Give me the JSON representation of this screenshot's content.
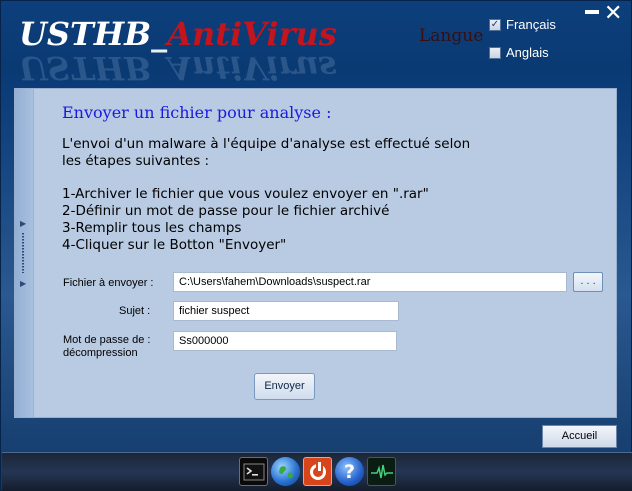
{
  "header": {
    "logo_part1": "USTHB_",
    "logo_part2": "AntiVirus",
    "logo_full": "USTHB_AntiVirus",
    "langue_label": "Langue",
    "lang_options": [
      {
        "label": "Français",
        "checked": true
      },
      {
        "label": "Anglais",
        "checked": false
      }
    ]
  },
  "panel": {
    "title": "Envoyer un fichier pour analyse :",
    "intro_line1": "L'envoi d'un malware à  l'équipe d'analyse est effectué selon",
    "intro_line2": "les étapes suivantes :",
    "steps": [
      "1-Archiver le fichier que vous voulez envoyer en \".rar\"",
      "2-Définir un mot de passe pour le fichier archivé",
      "3-Remplir tous les champs",
      "4-Cliquer sur le Botton \"Envoyer\""
    ],
    "fields": {
      "file_label": "Fichier à envoyer :",
      "file_value": "C:\\Users\\fahem\\Downloads\\suspect.rar",
      "browse_label": ". . .",
      "subject_label": "Sujet :",
      "subject_value": "fichier suspect",
      "password_label": "Mot de passe de : décompression",
      "password_value": "Ss000000"
    },
    "send_label": "Envoyer"
  },
  "footer": {
    "home_label": "Accueil"
  },
  "taskbar": {
    "icons": [
      "terminal-icon",
      "globe-icon",
      "power-icon",
      "help-icon",
      "pulse-monitor-icon"
    ]
  },
  "colors": {
    "background": "#0b3c78",
    "panel": "#b9cbe3",
    "title_blue": "#1a1adf",
    "logo_red": "#c4141e"
  }
}
